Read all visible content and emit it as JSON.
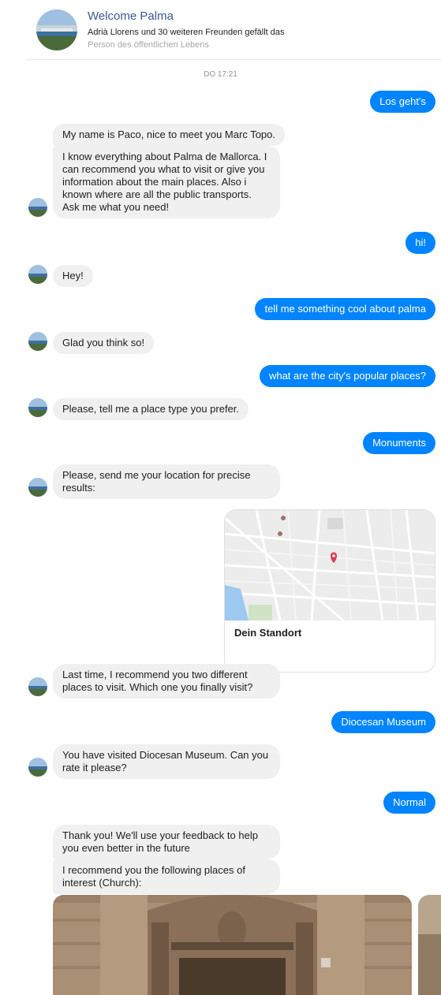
{
  "header": {
    "title": "Welcome Palma",
    "subtitle": "Adrià Llorens und 30 weiteren Freunden gefällt das",
    "category": "Person des öffentlichen Lebens"
  },
  "timestamp": "DO 17:21",
  "messages": {
    "m1": "Los geht's",
    "m2": "My name is Paco, nice to meet you Marc Topo.",
    "m3": "I know everything about Palma de Mallorca. I can recommend you what to visit or give you information about the main places. Also i known where are all the public transports. Ask me what you need!",
    "m4": "hi!",
    "m5": "Hey!",
    "m6": "tell me something cool about palma",
    "m7": "Glad you think so!",
    "m8": "what are the city's popular places?",
    "m9": "Please, tell me a place type you prefer.",
    "m10": "Monuments",
    "m11": "Please, send me your location for precise results:",
    "m12": "Last time, I recommend you two different places to visit. Which one you finally visit?",
    "m13": "Diocesan Museum",
    "m14": "You have visited Diocesan Museum. Can you rate it please?",
    "m15": "Normal",
    "m16": "Thank you! We'll use your feedback to help you even better in the future",
    "m17": "I recommend you the following places of interest (Church):"
  },
  "location_card": {
    "title": "Dein Standort"
  },
  "colors": {
    "outgoing": "#0084ff",
    "incoming": "#f1f0f0",
    "header_title": "#385898"
  }
}
